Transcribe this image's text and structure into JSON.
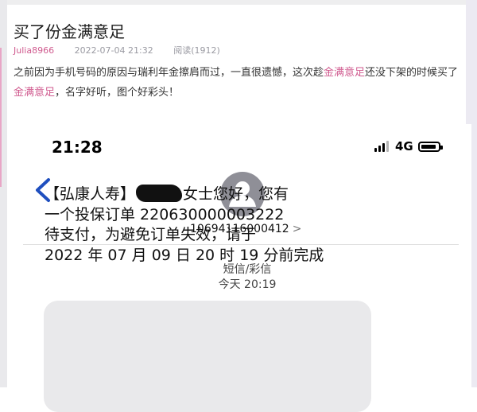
{
  "post": {
    "title": "买了份金满意足",
    "author": "Julia8966",
    "date": "2022-07-04 21:32",
    "reads": "阅读(1912)",
    "body": {
      "part1": "之前因为手机号码的原因与瑞利年金擦肩而过，一直很遗憾，这次趁",
      "highlight1": "金满意足",
      "part2": "还没下架的时候买了",
      "highlight2": "金满意足",
      "part3": "，名字好听，图个好彩头！"
    }
  },
  "phone": {
    "status": {
      "time": "21:28",
      "network": "4G"
    },
    "contact": {
      "number": "10694116000412",
      "chevron": ">"
    },
    "thread": {
      "type": "短信/彩信",
      "time": "今天 20:19"
    },
    "message": {
      "line1_a": "【弘康人寿】",
      "line1_b": "女士您好，您有",
      "line2": "一个投保订单 220630000003222",
      "line3": "待支付，为避免订单失效，请于",
      "line4": "2022 年 07 月 09 日 20 时 19 分前完成"
    }
  },
  "colors": {
    "accent": "#d05b8f",
    "back_chevron": "#1f4fbf",
    "bubble": "#e9e9eb"
  },
  "icons": [
    "back-chevron-icon",
    "contact-avatar-icon",
    "signal-icon",
    "battery-icon"
  ]
}
